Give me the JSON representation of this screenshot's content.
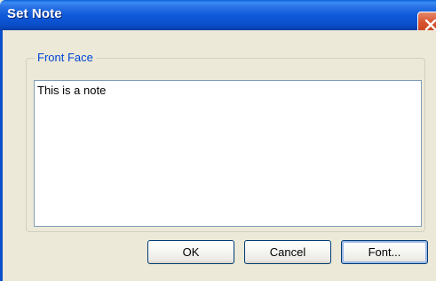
{
  "dialog": {
    "title": "Set Note"
  },
  "group": {
    "label": "Front Face"
  },
  "note": {
    "value": "This is a note"
  },
  "buttons": {
    "ok_label": "OK",
    "cancel_label": "Cancel",
    "font_label": "Font..."
  },
  "icons": {
    "close": "close-icon"
  },
  "colors": {
    "titlebar": "#0a4fcc",
    "window_bg": "#ece9d8",
    "group_label": "#0046d5",
    "close_button": "#d8522f"
  }
}
